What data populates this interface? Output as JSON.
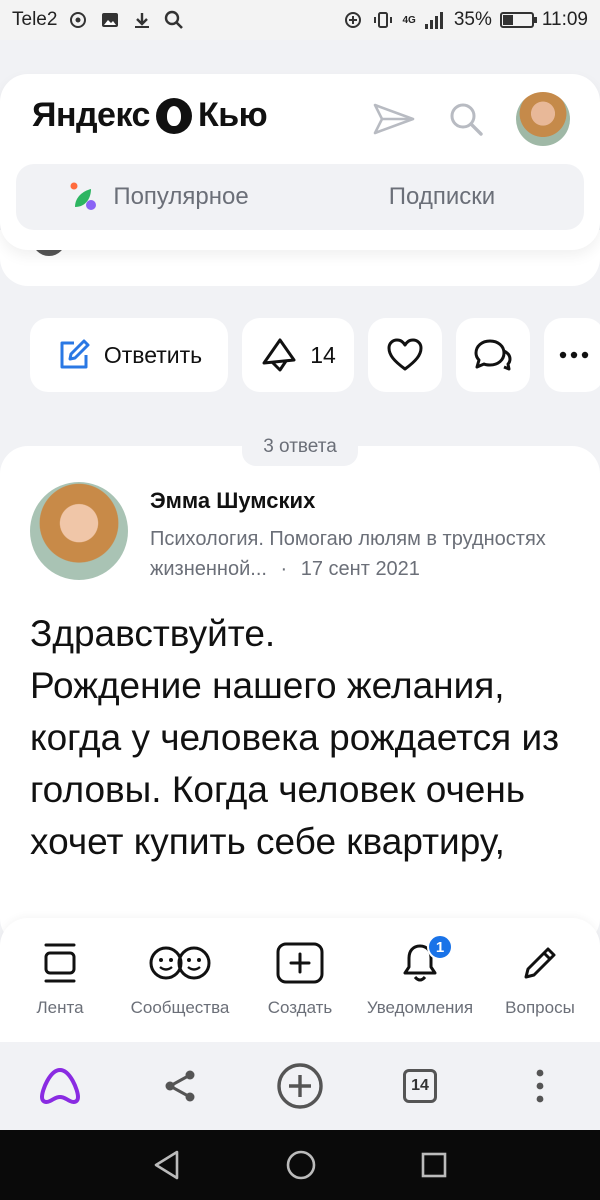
{
  "status_bar": {
    "carrier": "Tele2",
    "network": "4G",
    "battery": "35%",
    "battery_level": 0.35,
    "time": "11:09"
  },
  "header": {
    "logo_left": "Яндекс",
    "logo_right": "Кью",
    "tabs": [
      {
        "label": "Популярное",
        "icon": "popular-icon"
      },
      {
        "label": "Подписки"
      }
    ]
  },
  "actions": {
    "reply_label": "Ответить",
    "upvote_count": "14"
  },
  "answers_count": "3 ответа",
  "answer": {
    "author_name": "Эмма Шумских",
    "author_bio": "Психология. Помогаю люлям в трудностях жизненной...",
    "separator": "·",
    "date": "17 сент 2021",
    "text": "Здравствуйте.\nРождение нашего желания, когда у человека рождается из головы. Когда человек очень хочет купить себе квартиру,"
  },
  "bottom_nav": [
    {
      "label": "Лента",
      "icon": "feed-icon"
    },
    {
      "label": "Сообщества",
      "icon": "communities-icon"
    },
    {
      "label": "Создать",
      "icon": "create-icon"
    },
    {
      "label": "Уведомления",
      "icon": "bell-icon",
      "badge": "1"
    },
    {
      "label": "Вопросы",
      "icon": "pencil-icon"
    }
  ],
  "browser_bar": {
    "tab_count": "14"
  },
  "colors": {
    "accent_blue": "#1a73e8",
    "alice_purple": "#8a2be2",
    "background": "#f1f2f5"
  }
}
